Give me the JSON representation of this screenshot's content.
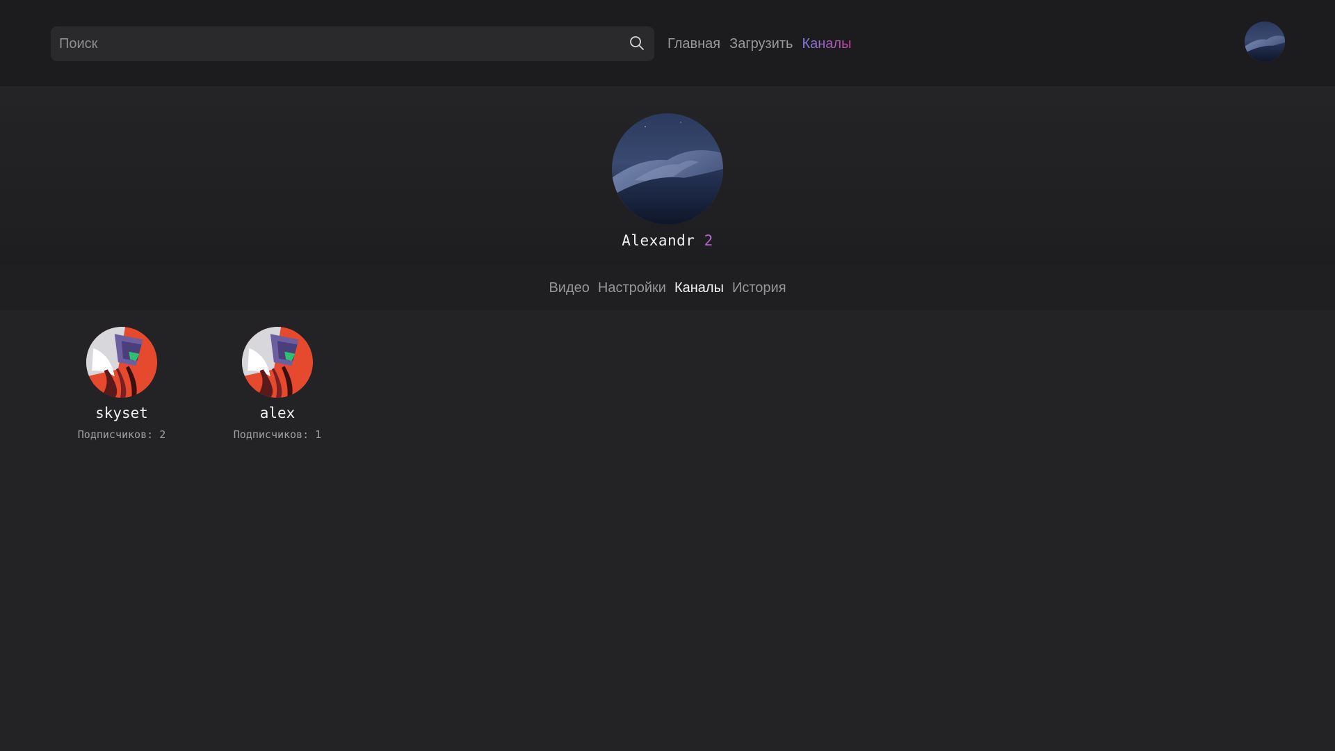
{
  "header": {
    "search": {
      "placeholder": "Поиск",
      "value": ""
    },
    "nav": [
      {
        "label": "Главная",
        "active": false
      },
      {
        "label": "Загрузить",
        "active": false
      },
      {
        "label": "Каналы",
        "active": true
      }
    ],
    "accent_gradient": [
      "#7d7fe6",
      "#c2449a"
    ]
  },
  "profile": {
    "name": "Alexandr",
    "count": "2",
    "count_color": "#b467c8"
  },
  "tabs": [
    {
      "label": "Видео",
      "active": false
    },
    {
      "label": "Настройки",
      "active": false
    },
    {
      "label": "Каналы",
      "active": true
    },
    {
      "label": "История",
      "active": false
    }
  ],
  "channels": [
    {
      "name": "skyset",
      "subscribers_label": "Подписчиков:",
      "subscribers": "2"
    },
    {
      "name": "alex",
      "subscribers_label": "Подписчиков:",
      "subscribers": "1"
    }
  ],
  "icons": {
    "search": "search-icon"
  }
}
